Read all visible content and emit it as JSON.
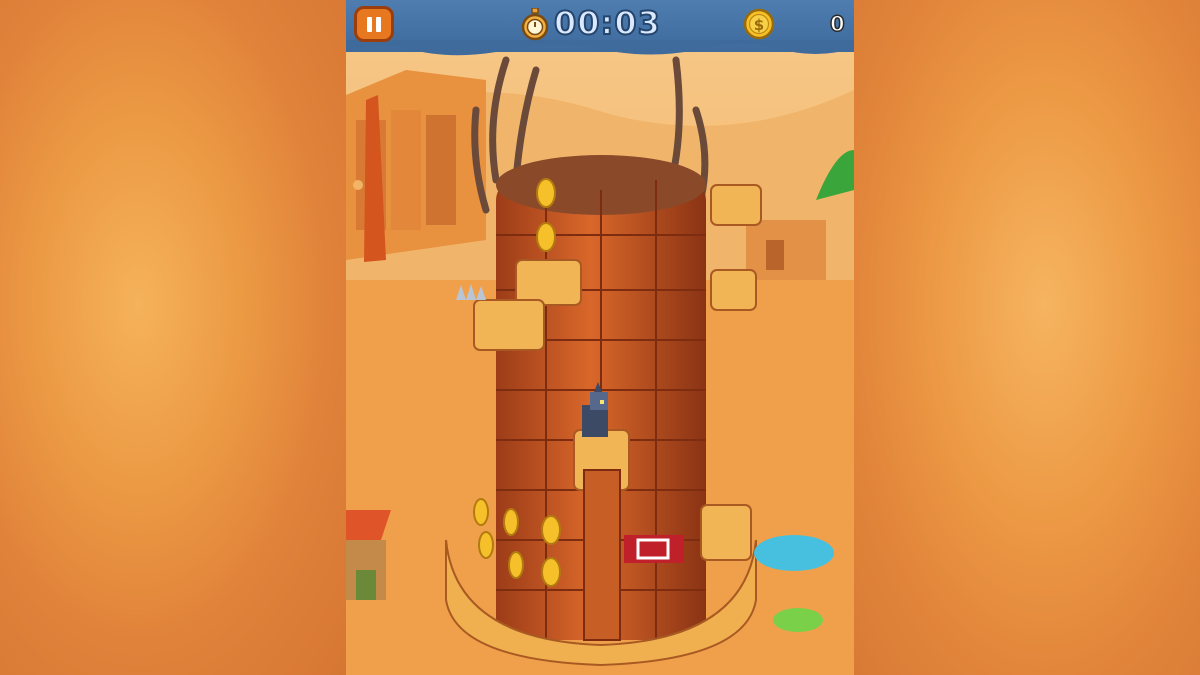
{
  "hud": {
    "pause_icon": "pause-icon",
    "timer_icon": "stopwatch-icon",
    "timer_value": "00:03",
    "coin_icon": "dollar-coin-icon",
    "coin_count": "0"
  },
  "colors": {
    "hud_bg": "#4878aa",
    "pause_button": "#e8781f",
    "sand": "#f2a24c",
    "brick": "#c45a24",
    "coin": "#f5c02a"
  }
}
